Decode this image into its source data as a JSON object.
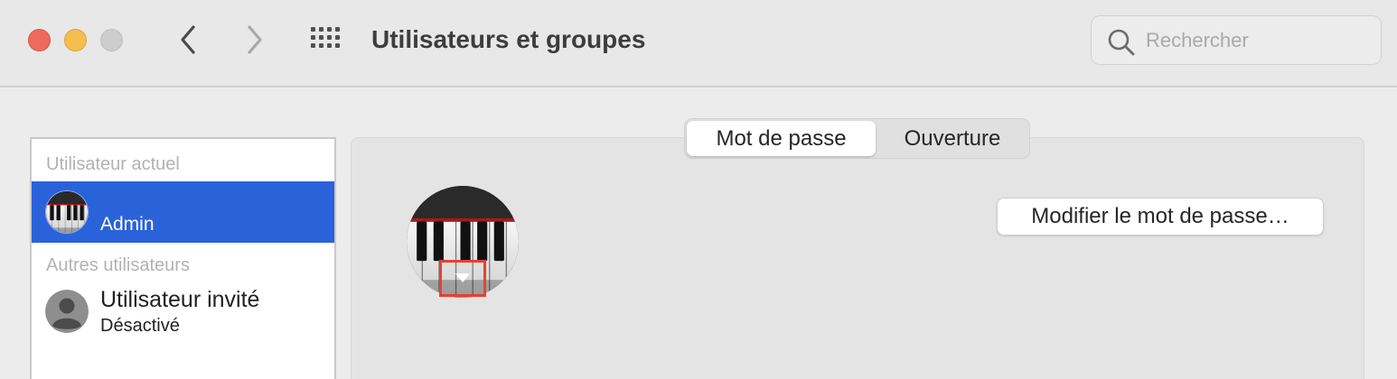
{
  "window": {
    "title": "Utilisateurs et groupes",
    "controls": [
      "close",
      "minimize",
      "zoom"
    ]
  },
  "toolbar": {
    "back_icon": "chevron-left-icon",
    "forward_icon": "chevron-right-icon",
    "show_all_icon": "grid-icon"
  },
  "search": {
    "placeholder": "Rechercher",
    "value": ""
  },
  "sidebar": {
    "current_header": "Utilisateur actuel",
    "current_user": {
      "name": "Admin",
      "avatar": "piano-keys"
    },
    "others_header": "Autres utilisateurs",
    "other_users": [
      {
        "name": "Utilisateur invité",
        "status": "Désactivé",
        "avatar": "default-person-icon"
      }
    ]
  },
  "tabs": {
    "items": [
      "Mot de passe",
      "Ouverture"
    ],
    "selected": "Mot de passe"
  },
  "main": {
    "avatar": "piano-keys",
    "modify_password_label": "Modifier le mot de passe…"
  },
  "colors": {
    "accent": "#2a62d9",
    "highlight_box": "#e8412f",
    "close": "#ed6a5e",
    "minimize": "#f5bf4f",
    "zoom_disabled": "#cdcdcd"
  }
}
